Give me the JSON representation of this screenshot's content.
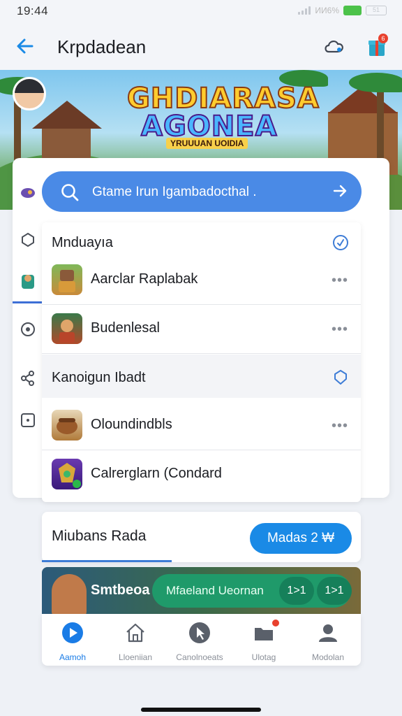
{
  "status_bar": {
    "time": "19:44",
    "network": "ИИ6%",
    "battery2": "51"
  },
  "app_bar": {
    "title": "Krpdadean",
    "gift_badge": "6"
  },
  "banner": {
    "title_line1": "GHDIARASA",
    "title_line2": "AGONEA",
    "subtitle": "YRUUUAN UOIDIA"
  },
  "search": {
    "text": "Gtame Irun Igambadocthal ."
  },
  "sections": [
    {
      "title": "Mnduayıa",
      "icon": "check-circle-icon",
      "rows": [
        {
          "label": "Aarclar Raplabak",
          "more": "•••"
        },
        {
          "label": "Budenlesal",
          "more": "•••"
        }
      ]
    },
    {
      "title": "Kanoigun Ibadt",
      "icon": "shield-icon",
      "rows": [
        {
          "label": "Oloundindbls",
          "more": "•••"
        },
        {
          "label": "Calrerglarn (Condard",
          "more": ""
        }
      ]
    }
  ],
  "secondary": {
    "title": "Miubans Rada",
    "button": "Madas 2 ₩"
  },
  "promo": {
    "title": "Smtbeoa",
    "pill_text": "Mfaeland Ueornan",
    "chip1": "1>1",
    "chip2": "1>1"
  },
  "bottom_nav": [
    {
      "label": "Aamoh",
      "icon": "play-icon",
      "active": true
    },
    {
      "label": "Lloeniian",
      "icon": "home-icon",
      "active": false
    },
    {
      "label": "Canolnoeats",
      "icon": "cursor-icon",
      "active": false
    },
    {
      "label": "Ulotag",
      "icon": "folder-icon",
      "active": false
    },
    {
      "label": "Modolan",
      "icon": "profile-icon",
      "active": false
    }
  ],
  "colors": {
    "accent": "#1a8ae6",
    "search_bg": "#4a8ae6",
    "promo_pill": "#1f9a6a",
    "badge": "#e8412e"
  }
}
